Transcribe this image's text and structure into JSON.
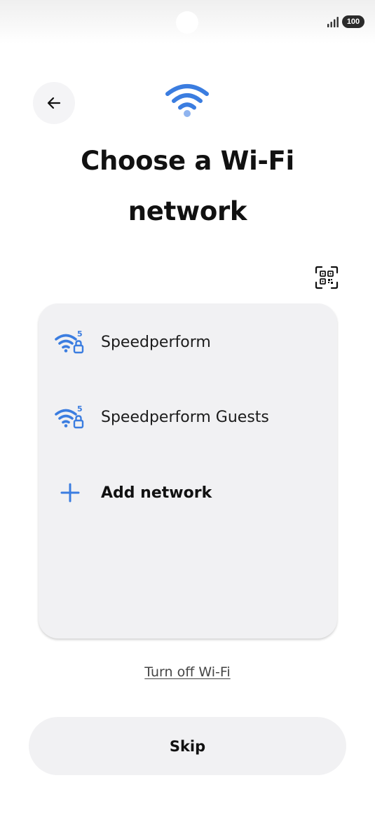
{
  "status_bar": {
    "battery": "100",
    "icons": [
      "camera-cutout",
      "signal-icon",
      "battery-icon"
    ]
  },
  "header": {
    "back_icon": "arrow-left-icon",
    "wifi_icon": "wifi-icon",
    "title_line1": "Choose a Wi-Fi",
    "title_line2": "network",
    "qr_icon": "qr-code-scan-icon"
  },
  "networks": [
    {
      "name": "Speedperform",
      "icon": "wifi-5ghz-lock-icon",
      "band": "5"
    },
    {
      "name": "Speedperform Guests",
      "icon": "wifi-5ghz-lock-icon",
      "band": "5"
    }
  ],
  "add_network": {
    "label": "Add network",
    "icon": "plus-icon"
  },
  "footer": {
    "turn_off_label": "Turn off Wi-Fi",
    "skip_label": "Skip"
  },
  "colors": {
    "accent": "#3b7de0",
    "card": "#f1f1f3",
    "text": "#111111"
  }
}
